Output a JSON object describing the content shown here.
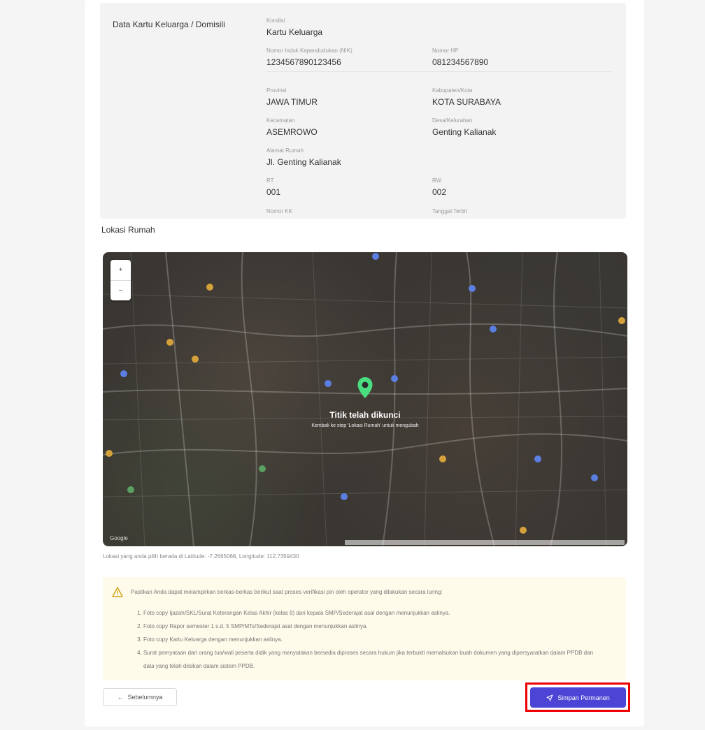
{
  "kk_section": {
    "title": "Data Kartu Keluarga / Domisili",
    "fields": {
      "kondisi": {
        "label": "Kondisi",
        "value": "Kartu Keluarga"
      },
      "nik": {
        "label": "Nomor Induk Kependudukan (NIK)",
        "value": "1234567890123456"
      },
      "hp": {
        "label": "Nomor HP",
        "value": "081234567890"
      },
      "provinsi": {
        "label": "Provinsi",
        "value": "JAWA TIMUR"
      },
      "kabupaten": {
        "label": "Kabupaten/Kota",
        "value": "KOTA SURABAYA"
      },
      "kecamatan": {
        "label": "Kecamatan",
        "value": "ASEMROWO"
      },
      "desa": {
        "label": "Desa/Kelurahan",
        "value": "Genting Kalianak"
      },
      "alamat": {
        "label": "Alamat Rumah",
        "value": "Jl. Genting Kalianak"
      },
      "rt": {
        "label": "RT",
        "value": "001"
      },
      "rw": {
        "label": "RW",
        "value": "002"
      },
      "nomor_kk": {
        "label": "Nomor KK",
        "value": ""
      },
      "tanggal_terbit": {
        "label": "Tanggal Terbit",
        "value": ""
      }
    }
  },
  "lokasi": {
    "title": "Lokasi Rumah",
    "zoom_in": "+",
    "zoom_out": "−",
    "lock_title": "Titik telah dikunci",
    "lock_subtitle": "Kembali ke step 'Lokasi Rumah' untuk mengubah",
    "google_logo": "Google",
    "coords_text": "Lokasi yang anda pilih berada di Latitude: -7.2665068, Longitude: 112.7359430",
    "pin_color": "#4ade80"
  },
  "notice": {
    "intro": "Pastikan Anda dapat melampirkan berkas-berkas berikut saat proses verifikasi pin oleh operator yang dilakukan secara luring:",
    "items": [
      "Foto copy Ijazah/SKL/Surat Keterangan Kelas Akhir (kelas 9) dari kepala SMP/Sederajat asal dengan menunjukkan aslinya.",
      "Foto copy Rapor semester 1 s.d. 5 SMP/MTs/Sederajat asal dengan menunjukkan aslinya.",
      "Foto copy Kartu Keluarga dengan menunjukkan aslinya.",
      "Surat pernyataan dari orang tua/wali peserta didik yang menyatakan bersedia diproses secara hukum jika terbukti memalsukan buah dokumen yang dipersyaratkan dalam PPDB dan data yang telah diisikan dalam sistem PPDB."
    ]
  },
  "buttons": {
    "prev": "Sebelumnya",
    "save": "Simpan Permanen"
  },
  "colors": {
    "primary": "#4b44d4",
    "highlight": "#ee0000",
    "notice_bg": "#fefbea"
  }
}
